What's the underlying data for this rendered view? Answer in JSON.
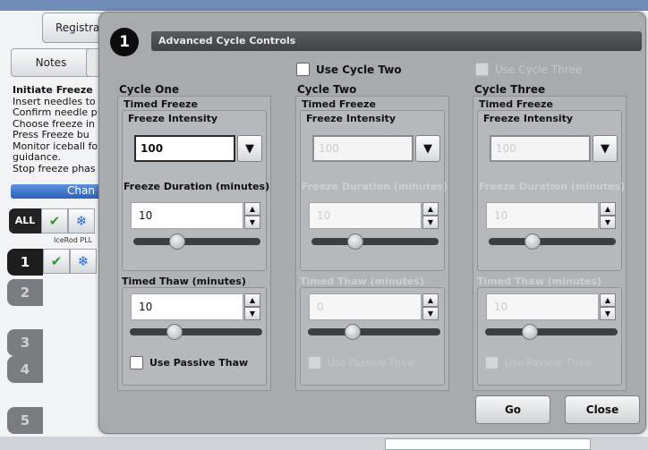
{
  "background": {
    "registration_btn": "Registra",
    "notes_btn": "Notes",
    "instructions": [
      "Initiate Freeze",
      "Insert needles to",
      "Confirm needle p",
      "Choose freeze in",
      "Press Freeze bu",
      "Monitor iceball fo",
      "guidance.",
      "Stop freeze phas"
    ],
    "change_btn": "Chan",
    "all_label": "ALL",
    "rod_label": "IceRod PLL",
    "rows": [
      "1",
      "2",
      "3",
      "4",
      "5"
    ]
  },
  "dialog": {
    "step_number": "1",
    "title": "Advanced Cycle Controls",
    "use_cycle_two": "Use Cycle Two",
    "use_cycle_three": "Use Cycle Three",
    "columns": [
      {
        "heading": "Cycle One",
        "sub": "Timed Freeze",
        "intensity_label": "Freeze Intensity",
        "intensity_value": "100",
        "duration_label": "Freeze Duration (minutes)",
        "duration_value": "10",
        "thaw_label": "Timed Thaw (minutes)",
        "thaw_value": "10",
        "passive_label": "Use Passive Thaw",
        "enabled": true
      },
      {
        "heading": "Cycle Two",
        "sub": "Timed Freeze",
        "intensity_label": "Freeze Intensity",
        "intensity_value": "100",
        "duration_label": "Freeze Duration (minutes)",
        "duration_value": "10",
        "thaw_label": "Timed Thaw (minutes)",
        "thaw_value": "0",
        "passive_label": "Use Passive Thaw",
        "enabled": false
      },
      {
        "heading": "Cycle Three",
        "sub": "Timed Freeze",
        "intensity_label": "Freeze Intensity",
        "intensity_value": "100",
        "duration_label": "Freeze Duration (minutes)",
        "duration_value": "10",
        "thaw_label": "Timed Thaw (minutes)",
        "thaw_value": "10",
        "passive_label": "Use Passive Thaw",
        "enabled": false
      }
    ],
    "go_btn": "Go",
    "close_btn": "Close"
  },
  "icons": {
    "dropdown": "▼",
    "spin_up": "▲",
    "spin_down": "▼",
    "needle": "✔",
    "snowflake": "❄"
  }
}
